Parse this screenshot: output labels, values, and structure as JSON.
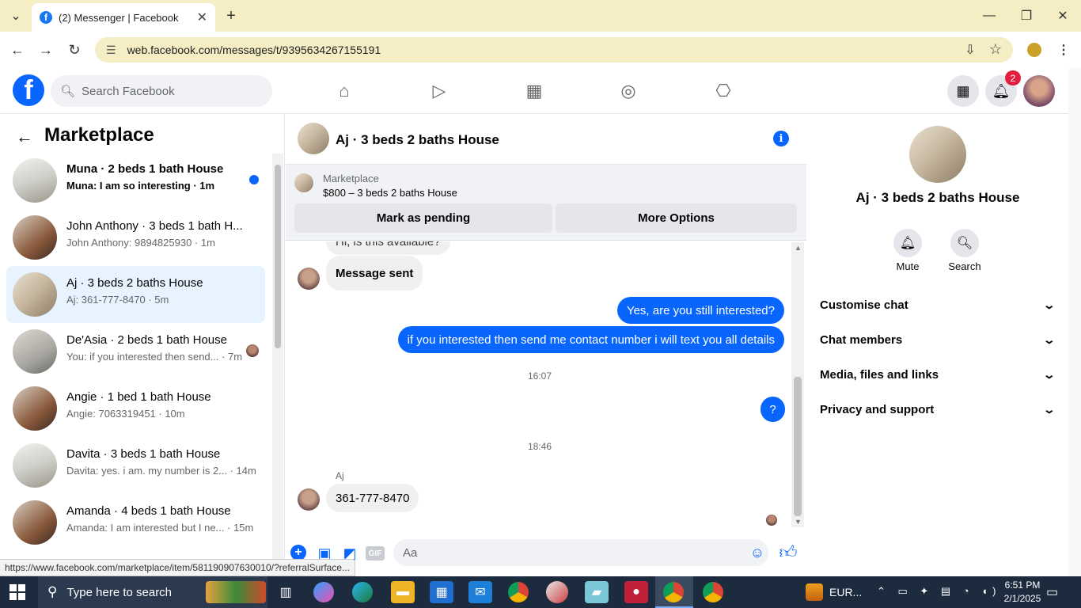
{
  "browser": {
    "tab_title": "(2) Messenger | Facebook",
    "url": "web.facebook.com/messages/t/9395634267155191",
    "status_url": "https://www.facebook.com/marketplace/item/581190907630010/?referralSurface..."
  },
  "fb": {
    "search_placeholder": "Search Facebook",
    "notification_count": "2"
  },
  "left": {
    "title": "Marketplace",
    "conversations": [
      {
        "title": "Muna · 2 beds 1 bath House",
        "preview": "Muna: I am so interesting · 1m",
        "unread": true
      },
      {
        "title": "John Anthony · 3 beds 1 bath H...",
        "preview": "John Anthony: 9894825930 · 1m"
      },
      {
        "title": "Aj · 3 beds 2 baths House",
        "preview": "Aj: 361-777-8470 · 5m",
        "selected": true
      },
      {
        "title": "De'Asia · 2 beds 1 bath House",
        "preview": "You: if you interested then send... · 7m"
      },
      {
        "title": "Angie · 1 bed 1 bath House",
        "preview": "Angie: 7063319451 · 10m"
      },
      {
        "title": "Davita · 3 beds 1 bath House",
        "preview": "Davita: yes. i am. my number is 2... · 14m"
      },
      {
        "title": "Amanda · 4 beds 1 bath House",
        "preview": "Amanda: I am interested but I ne... · 15m"
      }
    ]
  },
  "chat": {
    "title": "Aj · 3 beds 2 baths House",
    "marketplace_label": "Marketplace",
    "listing": "$800 – 3 beds 2 baths House",
    "mark_pending": "Mark as pending",
    "more_options": "More Options",
    "partial_msg": "Hi, is this available?",
    "messages": {
      "sent_system": "Message sent",
      "out1": "Yes, are you still interested?",
      "out2": "if you interested then send me contact number i will text you all details",
      "time1": "16:07",
      "out3": "?",
      "time2": "18:46",
      "sender": "Aj",
      "in1": "361-777-8470"
    },
    "composer_placeholder": "Aa"
  },
  "right": {
    "title": "Aj · 3 beds 2 baths House",
    "mute": "Mute",
    "search": "Search",
    "sections": [
      "Customise chat",
      "Chat members",
      "Media, files and links",
      "Privacy and support"
    ]
  },
  "taskbar": {
    "search_placeholder": "Type here to search",
    "tray_text": "EUR...",
    "time": "6:51 PM",
    "date": "2/1/2025"
  }
}
